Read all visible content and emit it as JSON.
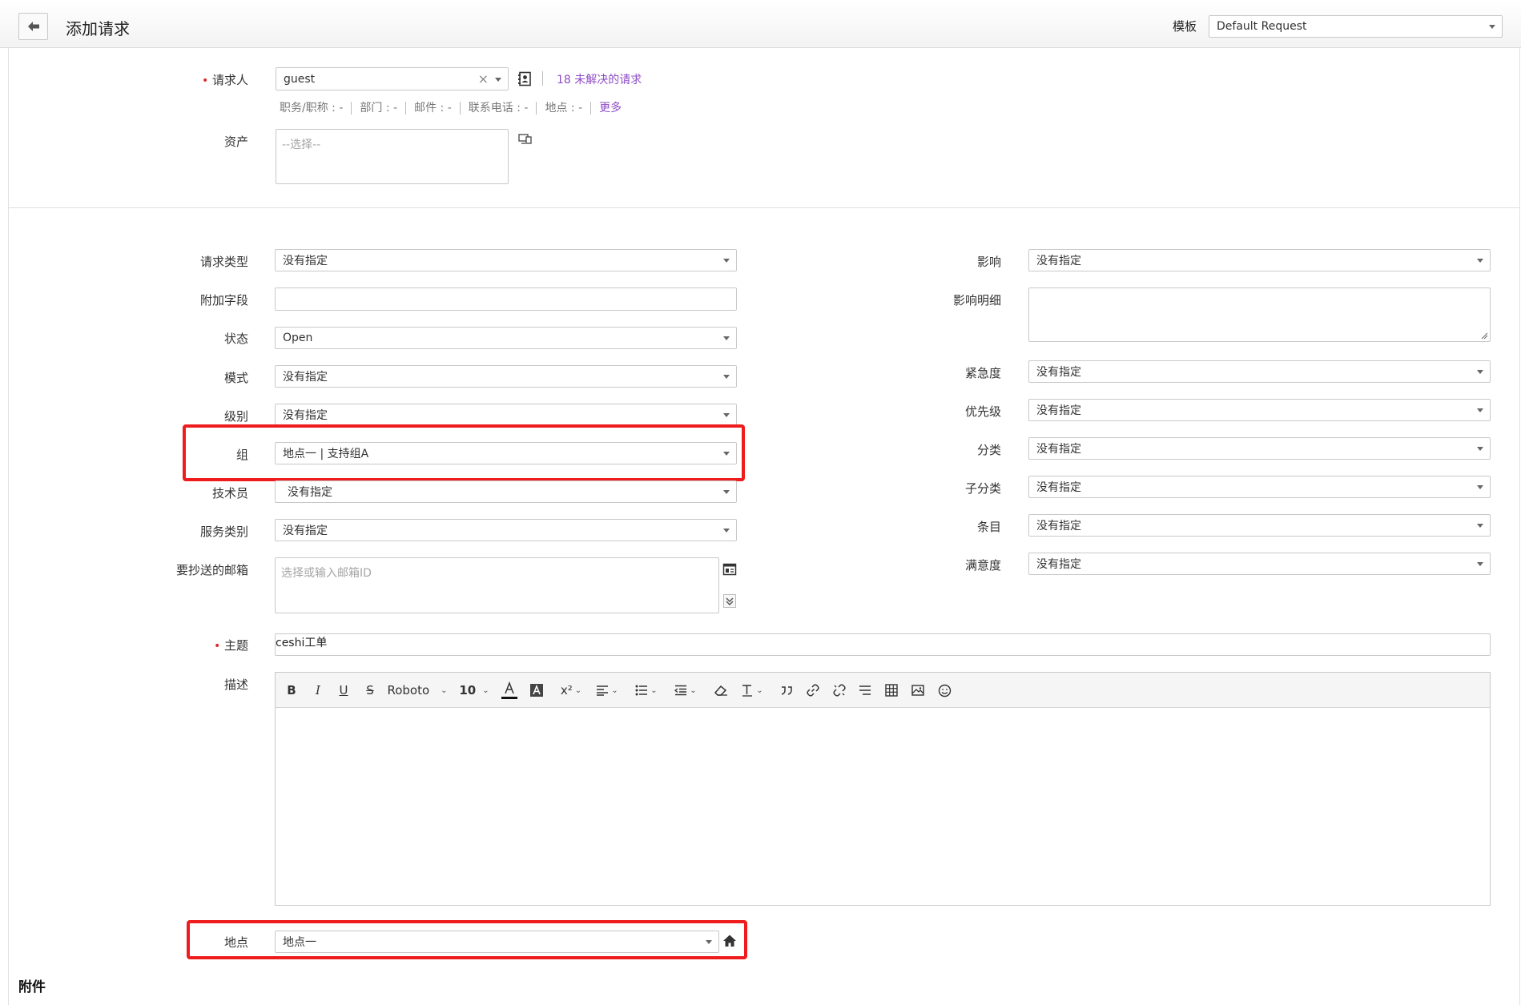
{
  "header": {
    "title": "添加请求",
    "template_label": "模板",
    "template_value": "Default Request"
  },
  "requester": {
    "label": "请求人",
    "value": "guest",
    "clear": "×",
    "open_requests_link": "18 未解决的请求",
    "info": [
      {
        "label": "职务/职称",
        "value": "-"
      },
      {
        "label": "部门",
        "value": "-"
      },
      {
        "label": "邮件",
        "value": "-"
      },
      {
        "label": "联系电话",
        "value": "-"
      },
      {
        "label": "地点",
        "value": "-"
      }
    ],
    "more_link": "更多"
  },
  "asset": {
    "label": "资产",
    "placeholder": "--选择--"
  },
  "left_fields": [
    {
      "label": "请求类型",
      "value": "没有指定"
    },
    {
      "label": "附加字段",
      "value": ""
    },
    {
      "label": "状态",
      "value": "Open"
    },
    {
      "label": "模式",
      "value": "没有指定"
    },
    {
      "label": "级别",
      "value": "没有指定"
    },
    {
      "label": "组",
      "value": "地点一 | 支持组A"
    },
    {
      "label": "技术员",
      "value": "没有指定"
    },
    {
      "label": "服务类别",
      "value": "没有指定"
    }
  ],
  "cc_email": {
    "label": "要抄送的邮箱",
    "placeholder": "选择或输入邮箱ID"
  },
  "right_fields": {
    "impact": {
      "label": "影响",
      "value": "没有指定"
    },
    "impact_detail": {
      "label": "影响明细",
      "value": ""
    },
    "others": [
      {
        "label": "紧急度",
        "value": "没有指定"
      },
      {
        "label": "优先级",
        "value": "没有指定"
      },
      {
        "label": "分类",
        "value": "没有指定"
      },
      {
        "label": "子分类",
        "value": "没有指定"
      },
      {
        "label": "条目",
        "value": "没有指定"
      },
      {
        "label": "满意度",
        "value": "没有指定"
      }
    ]
  },
  "subject": {
    "label": "主题",
    "value": "ceshi工单"
  },
  "description": {
    "label": "描述",
    "toolbar": {
      "bold": "B",
      "italic": "I",
      "underline": "U",
      "strike": "S",
      "font": "Roboto",
      "size": "10",
      "superscript": "x²"
    }
  },
  "location": {
    "label": "地点",
    "value": "地点一"
  },
  "attachments": {
    "title": "附件"
  },
  "colors": {
    "required": "#e0262b",
    "link": "#8e4bc7",
    "highlight": "#ee1c1c"
  }
}
